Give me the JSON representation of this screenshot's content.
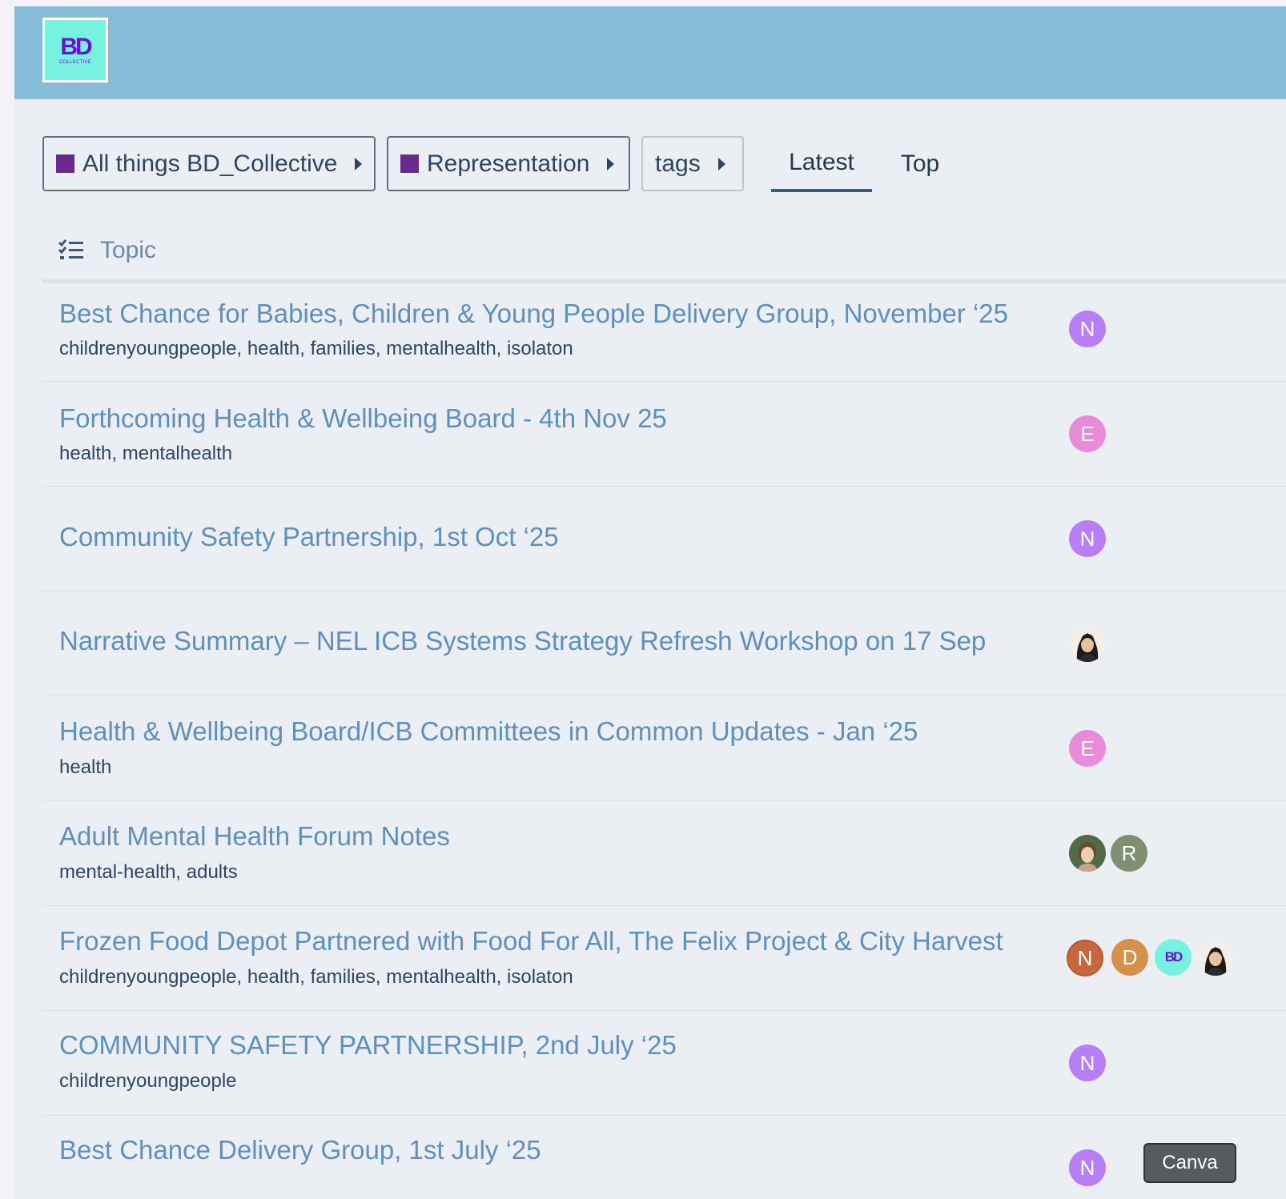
{
  "brand": {
    "logo_text": "BD",
    "logo_subtext": "COLLECTIVE",
    "logo_color": "#6a10d8",
    "logo_background": "#78f2e0",
    "header_color": "#85bdd8"
  },
  "nav": {
    "category_dropdown": "All things BD_Collective",
    "subcategory_dropdown": "Representation",
    "tags_dropdown": "tags",
    "category_swatch_color": "#6a2a8c",
    "tabs": [
      {
        "label": "Latest",
        "active": true
      },
      {
        "label": "Top",
        "active": false
      }
    ]
  },
  "list": {
    "column_header": "Topic",
    "column_icon": "checklist-icon",
    "topics": [
      {
        "title": "Best Chance for Babies, Children & Young People Delivery Group, November ‘25",
        "tags": "childrenyoungpeople, health, families, mentalhealth, isolaton",
        "posters": [
          {
            "letter": "N",
            "color": "#b77ef5"
          }
        ]
      },
      {
        "title": "Forthcoming Health & Wellbeing Board - 4th Nov 25",
        "tags": "health, mentalhealth",
        "posters": [
          {
            "letter": "E",
            "color": "#e98bd6"
          }
        ]
      },
      {
        "title": "Community Safety Partnership, 1st Oct ‘25",
        "tags": "",
        "posters": [
          {
            "letter": "N",
            "color": "#b77ef5"
          }
        ]
      },
      {
        "title": "Narrative Summary – NEL ICB Systems Strategy Refresh Workshop on 17 Sep",
        "tags": "",
        "posters": [
          {
            "letter": "",
            "color": "#f2efe9",
            "icon": "user-photo-icon"
          }
        ]
      },
      {
        "title": "Health & Wellbeing Board/ICB Committees in Common Updates - Jan ‘25",
        "tags": "health",
        "posters": [
          {
            "letter": "E",
            "color": "#e98bd6"
          }
        ]
      },
      {
        "title": "Adult Mental Health Forum Notes",
        "tags": "mental-health, adults",
        "posters": [
          {
            "letter": "",
            "color": "#5e7a5a",
            "icon": "user-photo-icon"
          },
          {
            "letter": "R",
            "color": "#7e8f72"
          }
        ]
      },
      {
        "title": "Frozen Food Depot Partnered with Food For All, The Felix Project & City Harvest",
        "tags": "childrenyoungpeople, health, families, mentalhealth, isolaton",
        "posters": [
          {
            "letter": "N",
            "color": "#c8673d"
          },
          {
            "letter": "D",
            "color": "#d6904a"
          },
          {
            "letter": "BD",
            "color": "#78f2e0",
            "icon": "bd-logo-icon"
          },
          {
            "letter": "",
            "color": "#f2efe9",
            "icon": "user-photo-icon"
          }
        ]
      },
      {
        "title": "COMMUNITY SAFETY PARTNERSHIP, 2nd July ‘25",
        "tags": "childrenyoungpeople",
        "posters": [
          {
            "letter": "N",
            "color": "#b77ef5"
          }
        ]
      },
      {
        "title": "Best Chance Delivery Group, 1st July ‘25",
        "tags": "",
        "posters": [
          {
            "letter": "N",
            "color": "#b77ef5"
          }
        ]
      }
    ]
  },
  "overlay": {
    "canva_label": "Canva"
  }
}
